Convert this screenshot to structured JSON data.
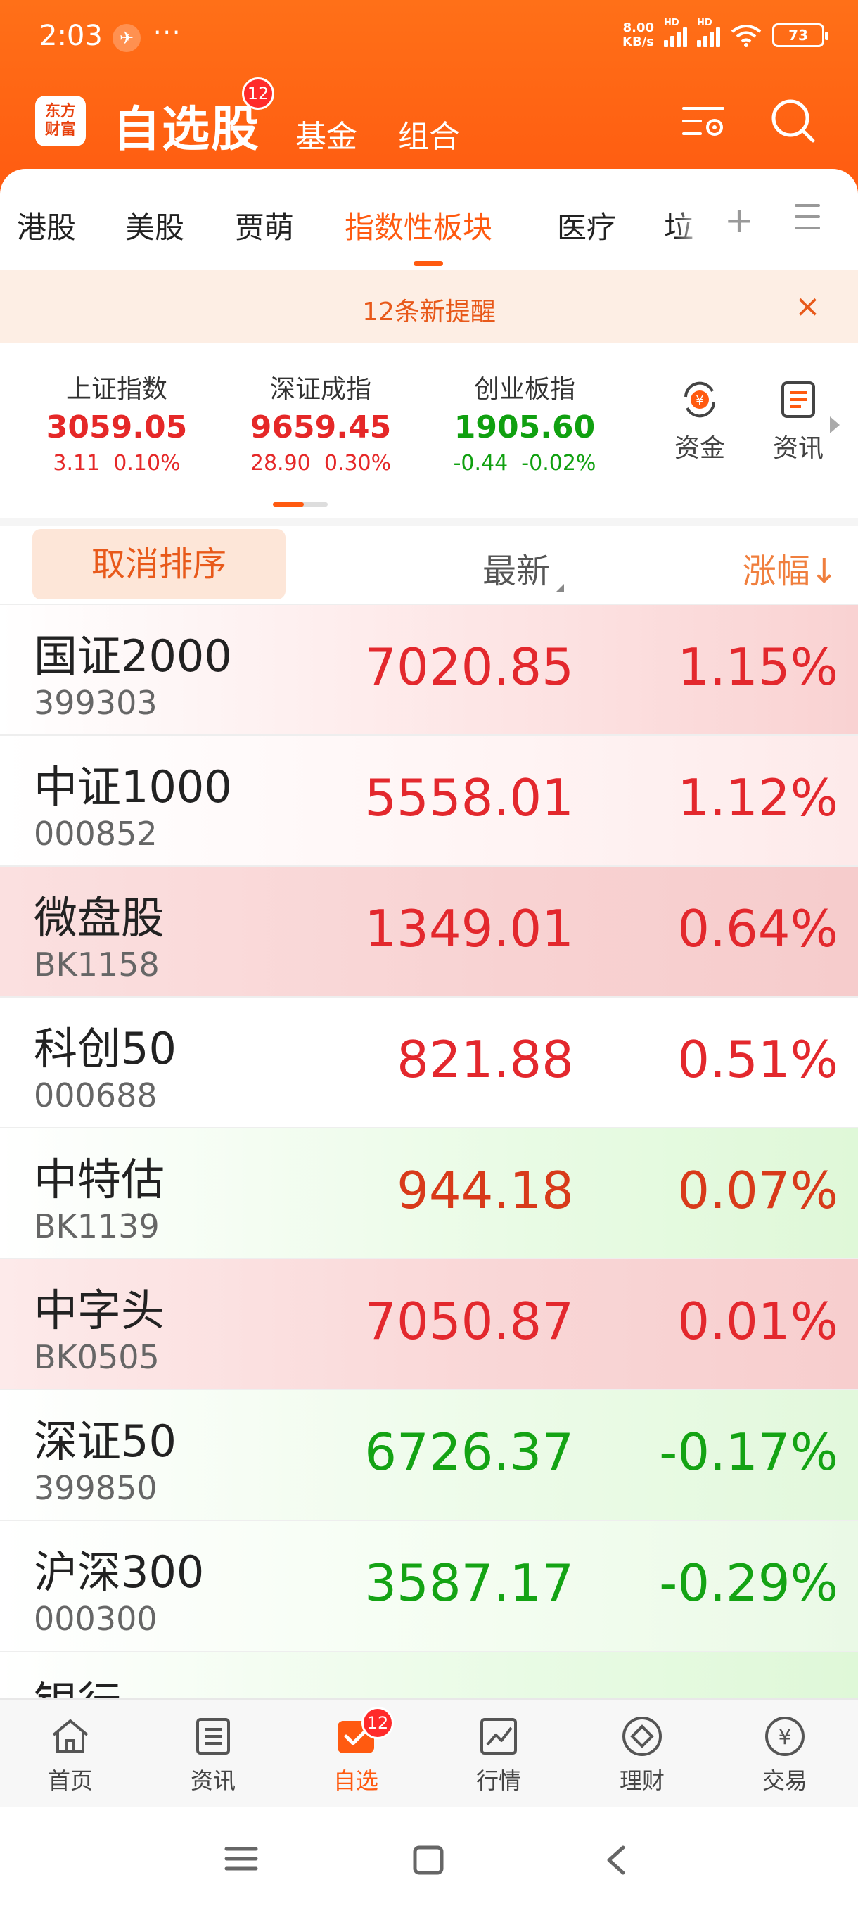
{
  "status_bar": {
    "time": "2:03",
    "dots": "···",
    "net_speed_value": "8.00",
    "net_speed_unit": "KB/s",
    "battery": "73"
  },
  "header": {
    "logo_line1": "东方",
    "logo_line2": "财富",
    "title": "自选股",
    "title_badge": "12",
    "fund": "基金",
    "combo": "组合"
  },
  "tabs": {
    "items": [
      "港股",
      "美股",
      "贾萌",
      "指数性板块",
      "医疗"
    ],
    "clipped": "垃圾",
    "active_index": 3
  },
  "notice": {
    "text": "12条新提醒",
    "close": "×"
  },
  "indices": [
    {
      "name": "上证指数",
      "value": "3059.05",
      "change": "3.11",
      "percent": "0.10%",
      "trend": "up"
    },
    {
      "name": "深证成指",
      "value": "9659.45",
      "change": "28.90",
      "percent": "0.30%",
      "trend": "up"
    },
    {
      "name": "创业板指",
      "value": "1905.60",
      "change": "-0.44",
      "percent": "-0.02%",
      "trend": "down"
    }
  ],
  "quick_links": {
    "funds": "资金",
    "news": "资讯"
  },
  "sort_bar": {
    "cancel": "取消排序",
    "latest": "最新",
    "change": "涨幅↓"
  },
  "stocks": [
    {
      "name": "国证2000",
      "code": "399303",
      "price": "7020.85",
      "pct": "1.15%"
    },
    {
      "name": "中证1000",
      "code": "000852",
      "price": "5558.01",
      "pct": "1.12%"
    },
    {
      "name": "微盘股",
      "code": "BK1158",
      "price": "1349.01",
      "pct": "0.64%"
    },
    {
      "name": "科创50",
      "code": "000688",
      "price": "821.88",
      "pct": "0.51%"
    },
    {
      "name": "中特估",
      "code": "BK1139",
      "price": "944.18",
      "pct": "0.07%"
    },
    {
      "name": "中字头",
      "code": "BK0505",
      "price": "7050.87",
      "pct": "0.01%"
    },
    {
      "name": "深证50",
      "code": "399850",
      "price": "6726.37",
      "pct": "-0.17%"
    },
    {
      "name": "沪深300",
      "code": "000300",
      "price": "3587.17",
      "pct": "-0.29%"
    },
    {
      "name": "银行",
      "code": "",
      "price": "",
      "pct": ""
    }
  ],
  "bottom_nav": {
    "home": "首页",
    "news": "资讯",
    "watchlist": "自选",
    "watchlist_badge": "12",
    "market": "行情",
    "wealth": "理财",
    "trade": "交易"
  },
  "colors": {
    "brand": "#ff5a10",
    "up": "#e3282d",
    "down": "#14a314"
  }
}
